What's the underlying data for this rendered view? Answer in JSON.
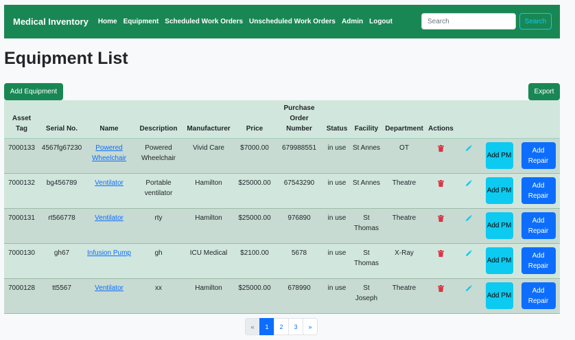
{
  "navbar": {
    "brand": "Medical Inventory",
    "links": [
      "Home",
      "Equipment",
      "Scheduled Work Orders",
      "Unscheduled Work Orders",
      "Admin",
      "Logout"
    ],
    "search_placeholder": "Search",
    "search_button": "Search",
    "color": "#198754"
  },
  "page": {
    "title": "Equipment List",
    "add_button": "Add Equipment",
    "export_button": "Export"
  },
  "table": {
    "headers": [
      "Asset Tag",
      "Serial No.",
      "Name",
      "Description",
      "Manufacturer",
      "Price",
      "Purchase Order Number",
      "Status",
      "Facility",
      "Department",
      "Actions"
    ],
    "rows": [
      {
        "asset_tag": "7000133",
        "serial": "4567fg67230",
        "name": "Powered Wheelchair",
        "description": "Powered Wheelchair",
        "manufacturer": "Vivid Care",
        "price": "$7000.00",
        "po": "679988551",
        "status": "in use",
        "facility": "St Annes",
        "department": "OT"
      },
      {
        "asset_tag": "7000132",
        "serial": "bg456789",
        "name": "Ventilator",
        "description": "Portable ventilator",
        "manufacturer": "Hamilton",
        "price": "$25000.00",
        "po": "67543290",
        "status": "in use",
        "facility": "St Annes",
        "department": "Theatre"
      },
      {
        "asset_tag": "7000131",
        "serial": "rt566778",
        "name": "Ventilator",
        "description": "rty",
        "manufacturer": "Hamilton",
        "price": "$25000.00",
        "po": "976890",
        "status": "in use",
        "facility": "St Thomas",
        "department": "Theatre"
      },
      {
        "asset_tag": "7000130",
        "serial": "gh67",
        "name": "Infusion Pump",
        "description": "gh",
        "manufacturer": "ICU Medical",
        "price": "$2100.00",
        "po": "5678",
        "status": "in use",
        "facility": "St Thomas",
        "department": "X-Ray"
      },
      {
        "asset_tag": "7000128",
        "serial": "tt5567",
        "name": "Ventilator",
        "description": "xx",
        "manufacturer": "Hamilton",
        "price": "$25000.00",
        "po": "678990",
        "status": "in use",
        "facility": "St Joseph",
        "department": "Theatre"
      }
    ],
    "add_pm_label": "Add PM",
    "add_repair_label": "Add Repair",
    "icons": {
      "delete": "trash-icon",
      "edit": "pencil-icon",
      "delete_color": "#dc3545",
      "edit_color": "#0dcaf0"
    }
  },
  "pagination": {
    "prev": "«",
    "pages": [
      "1",
      "2",
      "3"
    ],
    "next": "»",
    "current": "1"
  }
}
